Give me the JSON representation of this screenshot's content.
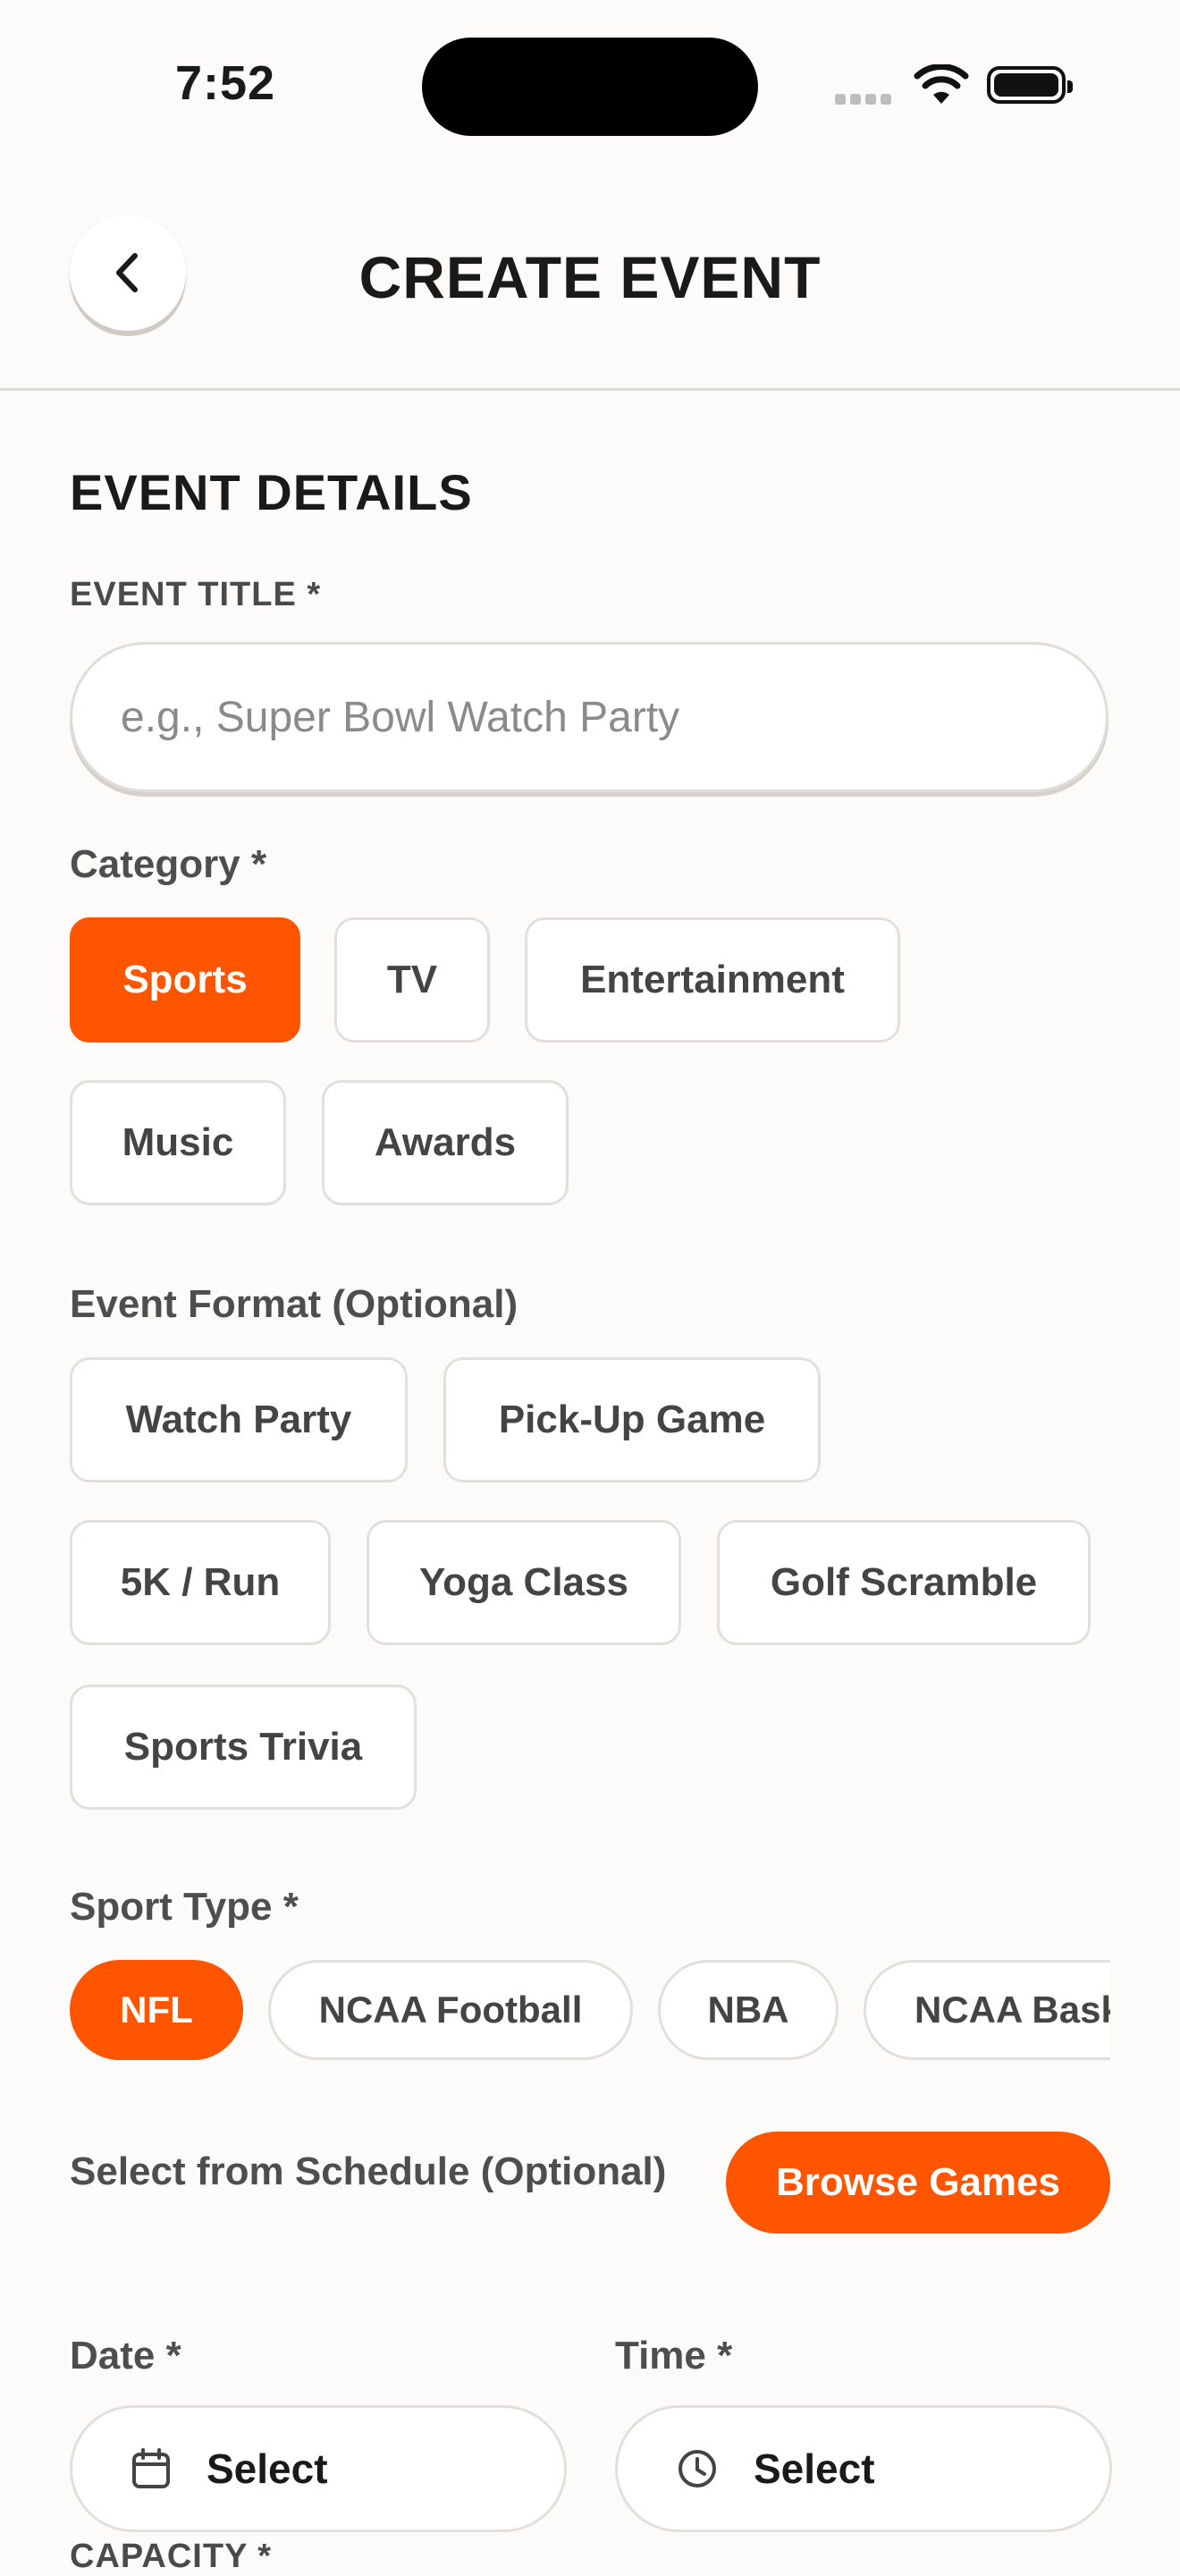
{
  "status_bar": {
    "time": "7:52"
  },
  "header": {
    "title": "CREATE EVENT",
    "back_icon": "chevron-left-icon"
  },
  "section": {
    "title": "EVENT DETAILS"
  },
  "event_title": {
    "label": "EVENT TITLE *",
    "placeholder": "e.g., Super Bowl Watch Party",
    "value": ""
  },
  "category": {
    "label": "Category *",
    "options": [
      "Sports",
      "TV",
      "Entertainment",
      "Music",
      "Awards"
    ],
    "selected": "Sports"
  },
  "event_format": {
    "label": "Event Format (Optional)",
    "options": [
      "Watch Party",
      "Pick-Up Game",
      "5K / Run",
      "Yoga Class",
      "Golf Scramble",
      "Sports Trivia"
    ]
  },
  "sport_type": {
    "label": "Sport Type *",
    "options": [
      "NFL",
      "NCAA Football",
      "NBA",
      "NCAA Basketball"
    ],
    "selected": "NFL"
  },
  "schedule": {
    "label": "Select from Schedule (Optional)",
    "button": "Browse Games"
  },
  "date": {
    "label": "Date *",
    "value": "Select",
    "icon": "calendar-icon"
  },
  "time": {
    "label": "Time *",
    "value": "Select",
    "icon": "clock-icon"
  },
  "capacity": {
    "label": "CAPACITY *"
  },
  "colors": {
    "accent": "#ff5400",
    "background": "#fcfbfa",
    "border": "#e3e0db"
  }
}
